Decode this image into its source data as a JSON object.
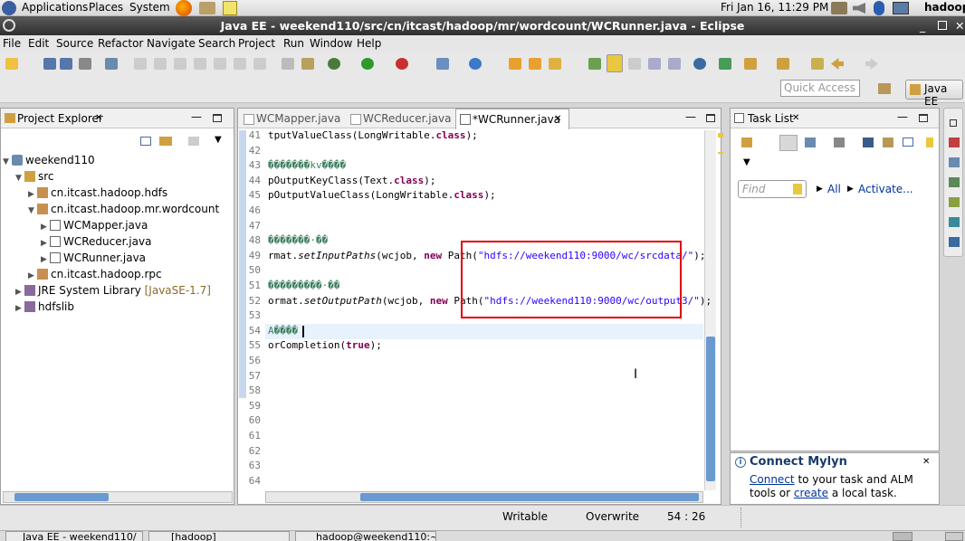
{
  "panel": {
    "applications": "Applications",
    "places": "Places",
    "system": "System",
    "datetime": "Fri Jan 16, 11:29 PM",
    "user": "hadoop"
  },
  "window": {
    "title": "Java EE - weekend110/src/cn/itcast/hadoop/mr/wordcount/WCRunner.java - Eclipse"
  },
  "menu": [
    "File",
    "Edit",
    "Source",
    "Refactor",
    "Navigate",
    "Search",
    "Project",
    "Run",
    "Window",
    "Help"
  ],
  "quick_access": {
    "placeholder": "Quick Access"
  },
  "perspective": {
    "label": "Java EE"
  },
  "project_explorer": {
    "title": "Project Explorer",
    "tree": [
      {
        "label": "weekend110",
        "level": 0,
        "expanded": true,
        "icon": "project-icon"
      },
      {
        "label": "src",
        "level": 1,
        "expanded": true,
        "icon": "source-folder-icon"
      },
      {
        "label": "cn.itcast.hadoop.hdfs",
        "level": 2,
        "expanded": false,
        "icon": "package-icon"
      },
      {
        "label": "cn.itcast.hadoop.mr.wordcount",
        "level": 2,
        "expanded": true,
        "icon": "package-icon"
      },
      {
        "label": "WCMapper.java",
        "level": 3,
        "expanded": false,
        "icon": "java-file-icon"
      },
      {
        "label": "WCReducer.java",
        "level": 3,
        "expanded": false,
        "icon": "java-file-icon"
      },
      {
        "label": "WCRunner.java",
        "level": 3,
        "expanded": false,
        "icon": "java-file-icon"
      },
      {
        "label": "cn.itcast.hadoop.rpc",
        "level": 2,
        "expanded": false,
        "icon": "package-icon"
      },
      {
        "label": "JRE System Library",
        "suffix": "[JavaSE-1.7]",
        "level": 0,
        "expanded": false,
        "icon": "library-icon"
      },
      {
        "label": "hdfslib",
        "level": 0,
        "expanded": false,
        "icon": "library-icon"
      }
    ]
  },
  "editor": {
    "tabs": [
      {
        "label": "WCMapper.java",
        "active": false
      },
      {
        "label": "WCReducer.java",
        "active": false
      },
      {
        "label": "*WCRunner.java",
        "active": true
      }
    ],
    "lines": [
      {
        "n": "41",
        "code": [
          [
            "",
            "tputValueClass(LongWritable."
          ],
          [
            "kw",
            "class"
          ],
          [
            "",
            ");"
          ]
        ]
      },
      {
        "n": "42",
        "code": []
      },
      {
        "n": "43",
        "code": [
          [
            "cm",
            "�������kv����"
          ]
        ]
      },
      {
        "n": "44",
        "code": [
          [
            "",
            "pOutputKeyClass(Text."
          ],
          [
            "kw",
            "class"
          ],
          [
            "",
            ");"
          ]
        ]
      },
      {
        "n": "45",
        "code": [
          [
            "",
            "pOutputValueClass(LongWritable."
          ],
          [
            "kw",
            "class"
          ],
          [
            "",
            ");"
          ]
        ]
      },
      {
        "n": "46",
        "code": []
      },
      {
        "n": "47",
        "code": []
      },
      {
        "n": "48",
        "code": [
          [
            "cm",
            "�������·��"
          ]
        ]
      },
      {
        "n": "49",
        "code": [
          [
            "",
            "rmat."
          ],
          [
            "it",
            "setInputPaths"
          ],
          [
            "",
            "(wcjob, "
          ],
          [
            "kw",
            "new"
          ],
          [
            "",
            " Path("
          ],
          [
            "str",
            "\"hdfs://weekend110:9000/wc/srcdata/\""
          ],
          [
            "",
            ");"
          ]
        ]
      },
      {
        "n": "50",
        "code": []
      },
      {
        "n": "51",
        "code": [
          [
            "cm",
            "���������·��"
          ]
        ]
      },
      {
        "n": "52",
        "code": [
          [
            "",
            "ormat."
          ],
          [
            "it",
            "setOutputPath"
          ],
          [
            "",
            "(wcjob, "
          ],
          [
            "kw",
            "new"
          ],
          [
            "",
            " Path("
          ],
          [
            "str",
            "\"hdfs://weekend110:9000/wc/output3/\""
          ],
          [
            "",
            ");"
          ]
        ]
      },
      {
        "n": "53",
        "code": []
      },
      {
        "n": "54",
        "code": [
          [
            "cm",
            "A����"
          ]
        ]
      },
      {
        "n": "55",
        "code": [
          [
            "",
            "orCompletion("
          ],
          [
            "kw",
            "true"
          ],
          [
            "",
            ");"
          ]
        ]
      },
      {
        "n": "56",
        "code": []
      },
      {
        "n": "57",
        "code": []
      },
      {
        "n": "58",
        "code": []
      },
      {
        "n": "59",
        "code": []
      },
      {
        "n": "60",
        "code": []
      },
      {
        "n": "61",
        "code": []
      },
      {
        "n": "62",
        "code": []
      },
      {
        "n": "63",
        "code": []
      },
      {
        "n": "64",
        "code": []
      }
    ]
  },
  "task_list": {
    "title": "Task List",
    "find_placeholder": "Find",
    "all": "All",
    "activate": "Activate..."
  },
  "mylyn": {
    "title": "Connect Mylyn",
    "connect": "Connect",
    "text1": " to your task and ALM tools or",
    "create": "create",
    "text2": " a local task."
  },
  "status": {
    "writable": "Writable",
    "mode": "Overwrite",
    "position": "54 : 26"
  },
  "taskbar": [
    "Java EE - weekend110/",
    "[hadoop]",
    "hadoop@weekend110:~"
  ]
}
